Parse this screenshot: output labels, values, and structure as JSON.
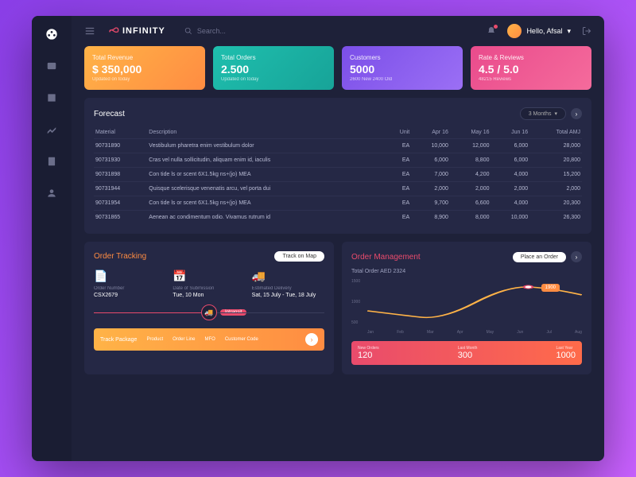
{
  "header": {
    "brand": "INFINITY",
    "search_placeholder": "Search...",
    "greeting": "Hello, Afsal"
  },
  "stats": [
    {
      "label": "Total Revenue",
      "value": "$ 350,000",
      "sub": "Updated on today"
    },
    {
      "label": "Total Orders",
      "value": "2.500",
      "sub": "Updated on today"
    },
    {
      "label": "Customers",
      "value": "5000",
      "sub": "2600 New   2400 Old"
    },
    {
      "label": "Rate & Reviews",
      "value": "4.5 / 5.0",
      "sub": "48215 Reviews"
    }
  ],
  "forecast": {
    "title": "Forecast",
    "range_label": "3 Months",
    "columns": [
      "Material",
      "Description",
      "Unit",
      "Apr 16",
      "May 16",
      "Jun 16",
      "Total AMJ"
    ],
    "rows": [
      [
        "90731890",
        "Vestibulum pharetra enim vestibulum dolor",
        "EA",
        "10,000",
        "12,000",
        "6,000",
        "28,000"
      ],
      [
        "90731930",
        "Cras vel nulla sollicitudin, aliquam enim id, iaculis",
        "EA",
        "6,000",
        "8,800",
        "6,000",
        "20,800"
      ],
      [
        "90731898",
        "Con tide ls or scent 6X1.5kg ns+(jo) MEA",
        "EA",
        "7,000",
        "4,200",
        "4,000",
        "15,200"
      ],
      [
        "90731944",
        "Quisque scelerisque venenatis arcu, vel porta dui",
        "EA",
        "2,000",
        "2,000",
        "2,000",
        "2,000"
      ],
      [
        "90731954",
        "Con tide ls or scent 6X1.5kg ns+(jo) MEA",
        "EA",
        "9,700",
        "6,600",
        "4,000",
        "20,300"
      ],
      [
        "90731865",
        "Aenean ac condimentum odio. Vivamus rutrum id",
        "EA",
        "8,900",
        "8,000",
        "10,000",
        "26,300"
      ]
    ]
  },
  "tracking": {
    "title": "Order Tracking",
    "button": "Track on Map",
    "items": [
      {
        "label": "Order Number",
        "value": "CSX2679"
      },
      {
        "label": "Date of Submission",
        "value": "Tue, 10 Mon"
      },
      {
        "label": "Estimated Delivery",
        "value": "Sat, 15 July - Tue, 18 July"
      }
    ],
    "status": "Intransit",
    "footer_title": "Track Package",
    "footer_items": [
      "Product",
      "Order Line",
      "MFO",
      "Customer Code"
    ]
  },
  "management": {
    "title": "Order Management",
    "button": "Place an Order",
    "total_label": "Total Order AED 2324",
    "chart_badge": "1900",
    "y_ticks": [
      "1500",
      "1000",
      "500"
    ],
    "x_ticks": [
      "Jan",
      "Feb",
      "Mar",
      "Apr",
      "May",
      "Jun",
      "Jul",
      "Aug"
    ],
    "footer": [
      {
        "label": "New Orders",
        "value": "120"
      },
      {
        "label": "Last Month",
        "value": "300"
      },
      {
        "label": "Last Year",
        "value": "1000"
      }
    ]
  },
  "chart_data": {
    "type": "line",
    "title": "Order Management",
    "x": [
      "Jan",
      "Feb",
      "Mar",
      "Apr",
      "May",
      "Jun",
      "Jul",
      "Aug"
    ],
    "values": [
      600,
      550,
      450,
      700,
      1200,
      1600,
      1900,
      1400
    ],
    "ylim": [
      0,
      1600
    ],
    "annotation": {
      "x": "Jul",
      "value": 1900
    }
  }
}
